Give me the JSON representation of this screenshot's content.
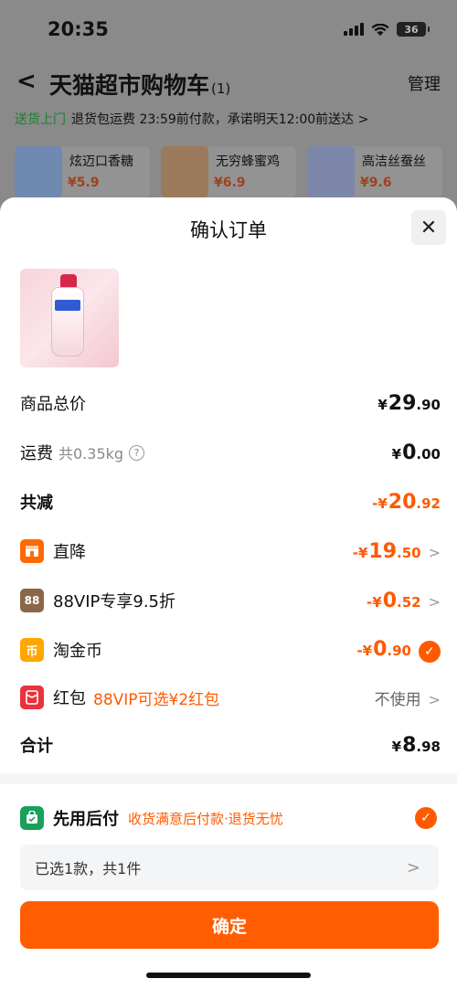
{
  "status_bar": {
    "time": "20:35",
    "battery": "36"
  },
  "cart_header": {
    "back": "<",
    "title": "天猫超市购物车",
    "count": "(1)",
    "manage": "管理"
  },
  "delivery": {
    "tag": "送货上门",
    "text": "退货包运费 23:59前付款，承诺明天12:00前送达 >"
  },
  "recommendations": [
    {
      "name": "炫迈口香糖",
      "price": "¥5.9"
    },
    {
      "name": "无穷蜂蜜鸡",
      "price": "¥6.9"
    },
    {
      "name": "高洁丝蚕丝",
      "price": "¥9.6"
    }
  ],
  "sheet": {
    "title": "确认订单",
    "close": "✕",
    "rows": {
      "subtotal": {
        "label": "商品总价",
        "cur": "¥",
        "int": "29",
        "dec": ".90"
      },
      "shipping": {
        "label": "运费",
        "weight": "共0.35kg",
        "help": "?",
        "cur": "¥",
        "int": "0",
        "dec": ".00"
      },
      "discount": {
        "label": "共减",
        "cur": "-¥",
        "int": "20",
        "dec": ".92"
      },
      "direct": {
        "label": "直降",
        "cur": "-¥",
        "int": "19",
        "dec": ".50",
        "chev": ">"
      },
      "vip": {
        "badge": "88",
        "label": "88VIP专享9.5折",
        "cur": "-¥",
        "int": "0",
        "dec": ".52",
        "chev": ">"
      },
      "coin": {
        "badge": "币",
        "label": "淘金币",
        "cur": "-¥",
        "int": "0",
        "dec": ".90",
        "check": "✓"
      },
      "redpacket": {
        "label": "红包",
        "promo": "88VIP可选¥2红包",
        "value": "不使用",
        "chev": ">"
      },
      "total": {
        "label": "合计",
        "cur": "¥",
        "int": "8",
        "dec": ".98"
      }
    },
    "pay_later": {
      "title": "先用后付",
      "sub": "收货满意后付款·退货无忧",
      "check": "✓"
    },
    "selected": {
      "text": "已选1款，共1件",
      "chev": ">"
    },
    "confirm": "确定"
  }
}
